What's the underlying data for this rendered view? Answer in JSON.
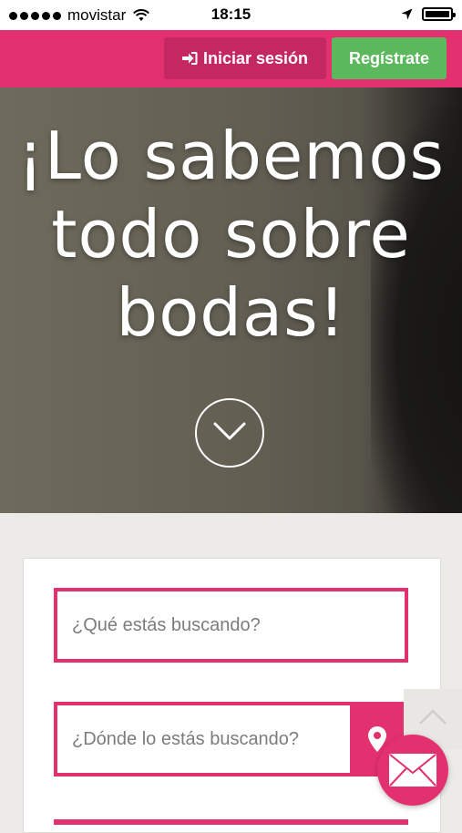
{
  "status_bar": {
    "carrier": "movistar",
    "time": "18:15"
  },
  "header": {
    "login_label": "Iniciar sesión",
    "register_label": "Regístrate",
    "brand_color": "#e3306f",
    "register_color": "#5cb85c"
  },
  "hero": {
    "title_line1": "¡Lo sabemos",
    "title_line2": "todo sobre",
    "title_line3": "bodas!"
  },
  "search": {
    "what_placeholder": "¿Qué estás buscando?",
    "where_placeholder": "¿Dónde lo estás buscando?"
  },
  "icons": {
    "login": "sign-in-icon",
    "scroll_down": "chevron-down-icon",
    "location": "map-marker-icon",
    "scroll_top": "chevron-up-icon",
    "mail": "envelope-icon"
  }
}
